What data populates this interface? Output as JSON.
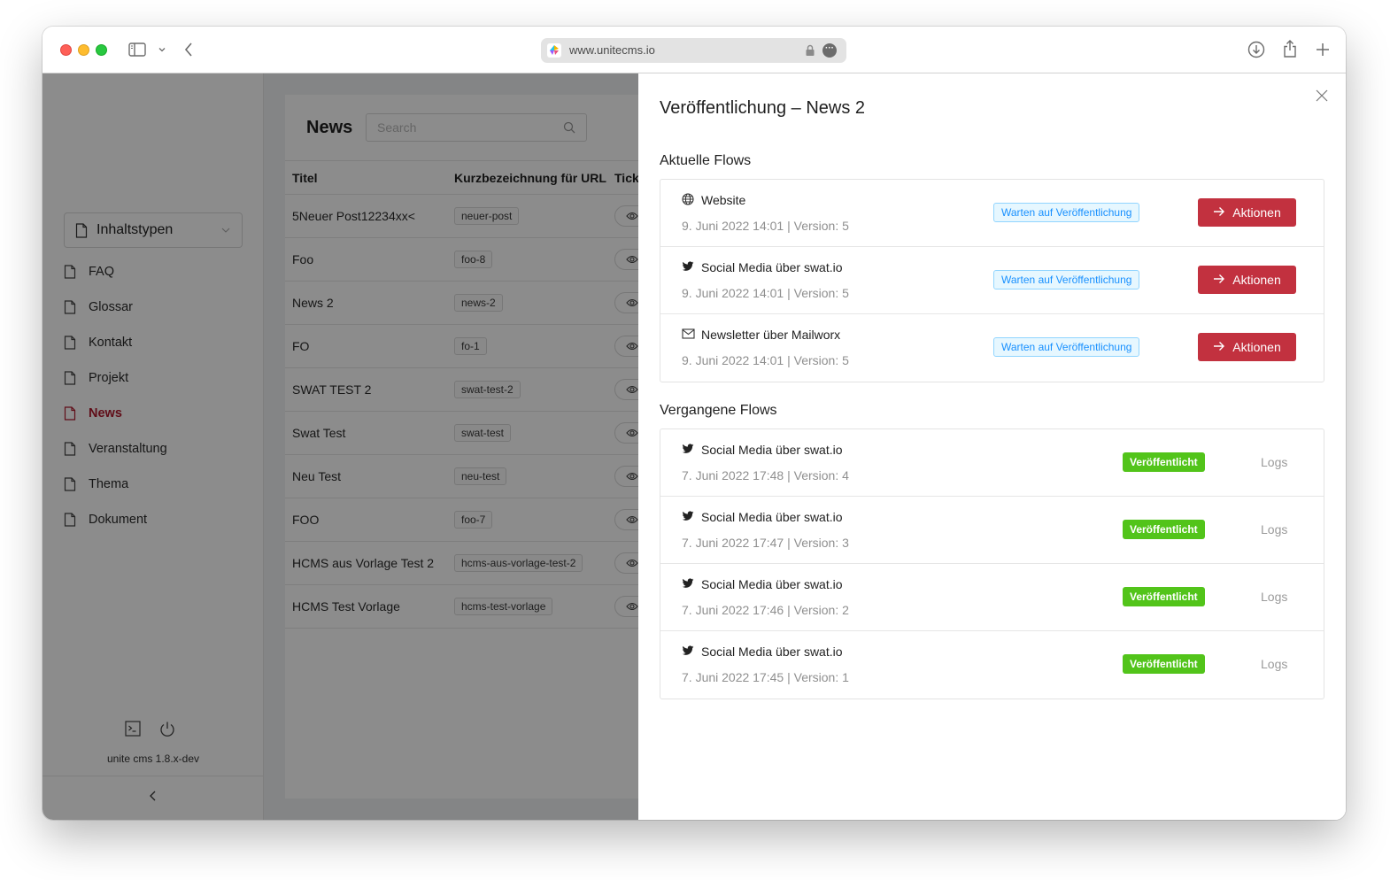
{
  "browser": {
    "url": "www.unitecms.io",
    "icons": [
      "sidebar-toggle-icon",
      "chevron-down-icon",
      "back-icon",
      "lock-icon",
      "more-icon",
      "download-icon",
      "share-icon",
      "new-tab-icon"
    ]
  },
  "sidebar": {
    "content_type_select": "Inhaltstypen",
    "items": [
      {
        "label": "FAQ",
        "active": false
      },
      {
        "label": "Glossar",
        "active": false
      },
      {
        "label": "Kontakt",
        "active": false
      },
      {
        "label": "Projekt",
        "active": false
      },
      {
        "label": "News",
        "active": true
      },
      {
        "label": "Veranstaltung",
        "active": false
      },
      {
        "label": "Thema",
        "active": false
      },
      {
        "label": "Dokument",
        "active": false
      }
    ],
    "version": "unite cms 1.8.x-dev"
  },
  "list": {
    "title": "News",
    "search_placeholder": "Search",
    "columns": [
      "Titel",
      "Kurzbezeichnung für URL",
      "Tick"
    ],
    "rows": [
      {
        "title": "5Neuer Post12234xx<",
        "slug": "neuer-post"
      },
      {
        "title": "Foo",
        "slug": "foo-8"
      },
      {
        "title": "News 2",
        "slug": "news-2"
      },
      {
        "title": "FO",
        "slug": "fo-1"
      },
      {
        "title": "SWAT TEST 2",
        "slug": "swat-test-2"
      },
      {
        "title": "Swat Test",
        "slug": "swat-test"
      },
      {
        "title": "Neu Test",
        "slug": "neu-test"
      },
      {
        "title": "FOO",
        "slug": "foo-7"
      },
      {
        "title": "HCMS aus Vorlage Test 2",
        "slug": "hcms-aus-vorlage-test-2"
      },
      {
        "title": "HCMS Test Vorlage",
        "slug": "hcms-test-vorlage"
      }
    ]
  },
  "drawer": {
    "title": "Veröffentlichung – News 2",
    "current_title": "Aktuelle Flows",
    "past_title": "Vergangene Flows",
    "current": [
      {
        "icon": "globe-icon",
        "name": "Website",
        "meta": "9. Juni 2022 14:01 | Version: 5",
        "status": "Warten auf Veröffentlichung",
        "action": "Aktionen"
      },
      {
        "icon": "twitter-icon",
        "name": "Social Media über swat.io",
        "meta": "9. Juni 2022 14:01 | Version: 5",
        "status": "Warten auf Veröffentlichung",
        "action": "Aktionen"
      },
      {
        "icon": "mail-icon",
        "name": "Newsletter über Mailworx",
        "meta": "9. Juni 2022 14:01 | Version: 5",
        "status": "Warten auf Veröffentlichung",
        "action": "Aktionen"
      }
    ],
    "past": [
      {
        "icon": "twitter-icon",
        "name": "Social Media über swat.io",
        "meta": "7. Juni 2022 17:48 | Version: 4",
        "status": "Veröffentlicht",
        "action": "Logs"
      },
      {
        "icon": "twitter-icon",
        "name": "Social Media über swat.io",
        "meta": "7. Juni 2022 17:47 | Version: 3",
        "status": "Veröffentlicht",
        "action": "Logs"
      },
      {
        "icon": "twitter-icon",
        "name": "Social Media über swat.io",
        "meta": "7. Juni 2022 17:46 | Version: 2",
        "status": "Veröffentlicht",
        "action": "Logs"
      },
      {
        "icon": "twitter-icon",
        "name": "Social Media über swat.io",
        "meta": "7. Juni 2022 17:45 | Version: 1",
        "status": "Veröffentlicht",
        "action": "Logs"
      }
    ]
  },
  "colors": {
    "accent": "#c2313f",
    "active_nav": "#b0182d",
    "wait_badge": "#1890ff",
    "published_badge": "#52c41a"
  }
}
